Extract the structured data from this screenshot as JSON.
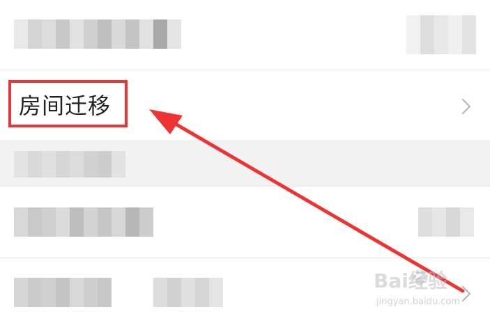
{
  "list": {
    "room_migration_label": "房间迁移"
  },
  "annotation": {
    "box_color": "#ee3333",
    "arrow_color": "#ee3333"
  },
  "watermark": {
    "brand": "Bai经验",
    "url": "jingyan.baidu.com"
  },
  "icons": {
    "chevron": "chevron-right-icon",
    "watermark_paw": "baidu-paw-icon"
  }
}
